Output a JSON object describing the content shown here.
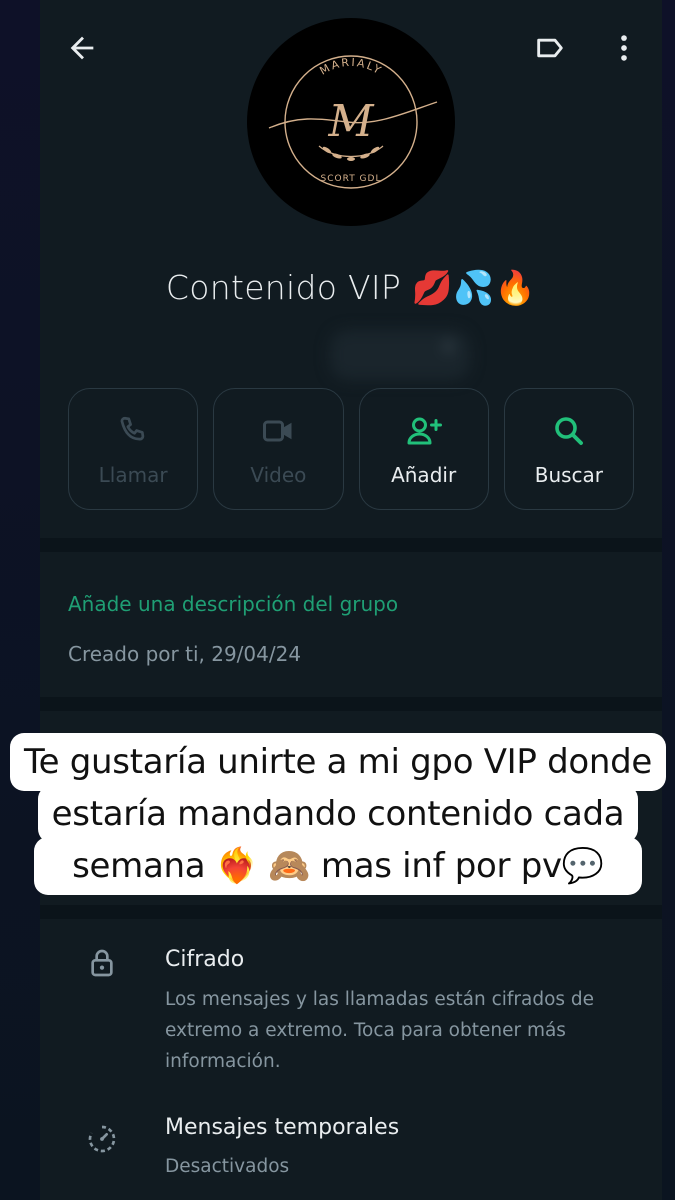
{
  "group": {
    "name": "Contenido VIP 💋💦🔥",
    "meta": "s",
    "avatar": {
      "top_text": "MARIALY",
      "monogram": "M",
      "bottom_text": "SCORT GDL"
    }
  },
  "actions": [
    {
      "label": "Llamar",
      "icon": "phone-icon",
      "enabled": false
    },
    {
      "label": "Video",
      "icon": "video-icon",
      "enabled": false
    },
    {
      "label": "Añadir",
      "icon": "add-person-icon",
      "enabled": true
    },
    {
      "label": "Buscar",
      "icon": "search-icon",
      "enabled": true
    }
  ],
  "description": {
    "add_link": "Añade una descripción del grupo",
    "created": "Creado por ti, 29/04/24"
  },
  "overlay": {
    "line1": "Te gustaría unirte a mi gpo VIP donde",
    "line2": "estaría mandando contenido cada",
    "line3": "semana ❤️‍🔥 🙈 mas inf por pv💬"
  },
  "settings": {
    "encryption": {
      "title": "Cifrado",
      "subtitle": "Los mensajes y las llamadas están cifrados de extremo a extremo. Toca para obtener más información.",
      "icon": "lock-icon"
    },
    "disappearing": {
      "title": "Mensajes temporales",
      "subtitle": "Desactivados",
      "icon": "timer-icon"
    }
  },
  "colors": {
    "accent": "#1f9f74",
    "panel": "#111b21",
    "background": "#0b141a"
  }
}
